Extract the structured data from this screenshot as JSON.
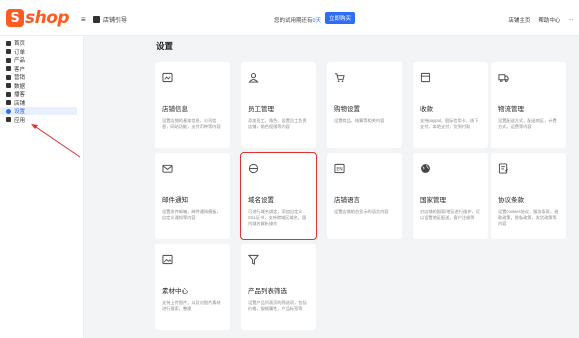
{
  "header": {
    "logo_mark": "S",
    "logo_text": "shop",
    "menu_icon": "≡",
    "guide_label": "店铺引导",
    "trial_prefix": "您的试用期还有",
    "trial_days": "0天",
    "trial_suffix": "",
    "buy_label": "立即购买",
    "links": [
      "店铺主页",
      "帮助中心",
      "..."
    ]
  },
  "sidebar": {
    "items": [
      {
        "label": "首页",
        "icon": "home-icon"
      },
      {
        "label": "订单",
        "icon": "order-icon"
      },
      {
        "label": "产品",
        "icon": "product-icon"
      },
      {
        "label": "客户",
        "icon": "customer-icon"
      },
      {
        "label": "营销",
        "icon": "marketing-icon"
      },
      {
        "label": "数据",
        "icon": "data-icon"
      },
      {
        "label": "播客",
        "icon": "podcast-icon"
      },
      {
        "label": "店铺",
        "icon": "store-icon"
      },
      {
        "label": "设置",
        "icon": "settings-icon",
        "active": true
      },
      {
        "label": "应用",
        "icon": "apps-icon"
      }
    ]
  },
  "main": {
    "title": "设置",
    "cards": [
      {
        "title": "店铺信息",
        "desc": "设置店铺的基本信息，公司信息，网站功能，支付币种等内容",
        "icon": "store-info-icon"
      },
      {
        "title": "员工管理",
        "desc": "添加员工，角色，设置员工负责店铺，角色权限等内容",
        "icon": "staff-icon"
      },
      {
        "title": "购物设置",
        "desc": "设置商品，结算等相关内容",
        "icon": "cart-icon"
      },
      {
        "title": "收款",
        "desc": "支持paypal，国际信用卡，线下支付，本地支付，货到付款",
        "icon": "payment-icon"
      },
      {
        "title": "物流管理",
        "desc": "设置配送方式，配送地区，计费方式，运费等内容",
        "icon": "truck-icon"
      },
      {
        "title": "邮件通知",
        "desc": "设置发件邮箱，邮件通知模板，自定义通知等内容",
        "icon": "mail-icon"
      },
      {
        "title": "域名设置",
        "desc": "可进行域名绑定，添加自定义SSL证书，支持跨域区域名，国内域名解析操作",
        "icon": "domain-icon",
        "highlight": true
      },
      {
        "title": "店铺语言",
        "desc": "设置店铺前台显示的语言内容",
        "icon": "language-icon"
      },
      {
        "title": "国家管理",
        "desc": "对店铺的国家/地区进行维护，可以设置地区配送，客户注册等",
        "icon": "globe-icon"
      },
      {
        "title": "协议条款",
        "desc": "设置cookies协议，服务条款，退款政策，隐私政策，发货政策等内容",
        "icon": "terms-icon"
      },
      {
        "title": "素材中心",
        "desc": "支持上传图片，以及对图片素材进行搜索，整理",
        "icon": "image-icon"
      },
      {
        "title": "产品列表筛选",
        "desc": "设置产品列表页的筛选项，包括价格，规格属性，产品标签等",
        "icon": "filter-icon"
      }
    ]
  },
  "colors": {
    "brand": "#ff5a1f",
    "accent": "#2f6df6",
    "highlight": "#e03131"
  }
}
